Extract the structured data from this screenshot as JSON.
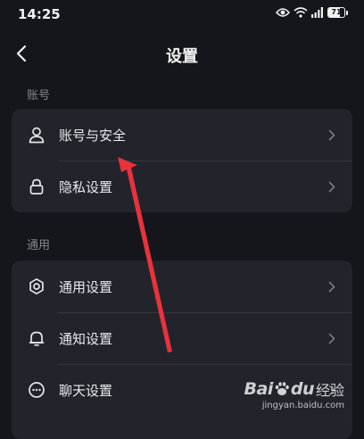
{
  "status_bar": {
    "time": "14:25",
    "battery_level": "71"
  },
  "header": {
    "title": "设置"
  },
  "sections": [
    {
      "label": "账号",
      "items": [
        {
          "label": "账号与安全",
          "icon": "person-icon"
        },
        {
          "label": "隐私设置",
          "icon": "lock-icon"
        }
      ]
    },
    {
      "label": "通用",
      "items": [
        {
          "label": "通用设置",
          "icon": "gear-icon"
        },
        {
          "label": "通知设置",
          "icon": "bell-icon"
        },
        {
          "label": "聊天设置",
          "icon": "chat-bubble-icon"
        }
      ]
    }
  ],
  "watermark": {
    "brand_latin_1": "Bai",
    "brand_latin_2": "du",
    "brand_cn": "经验",
    "url": "jingyan.baidu.com"
  },
  "colors": {
    "background": "#15161c",
    "card": "#23242b",
    "annotation_arrow": "#e8323c"
  }
}
